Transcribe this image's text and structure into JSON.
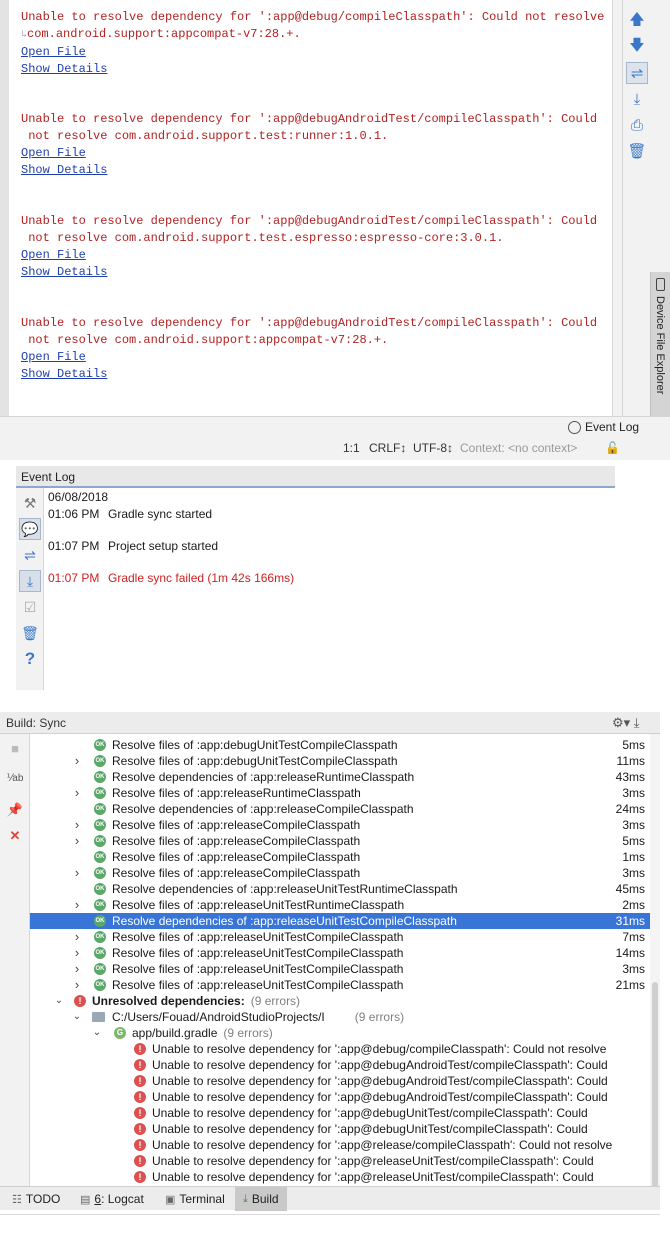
{
  "event_detail": {
    "messages": [
      {
        "line1": "Unable to resolve dependency for ':app@debug/compileClasspath': Could not resolve",
        "line2": "com.android.support:appcompat-v7:28.+.",
        "open_file": "Open File",
        "show_details": "Show Details"
      },
      {
        "line1": "Unable to resolve dependency for ':app@debugAndroidTest/compileClasspath': Could",
        "line2": " not resolve com.android.support.test:runner:1.0.1.",
        "open_file": "Open File",
        "show_details": "Show Details"
      },
      {
        "line1": "Unable to resolve dependency for ':app@debugAndroidTest/compileClasspath': Could",
        "line2": " not resolve com.android.support.test.espresso:espresso-core:3.0.1.",
        "open_file": "Open File",
        "show_details": "Show Details"
      },
      {
        "line1": "Unable to resolve dependency for ':app@debugAndroidTest/compileClasspath': Could",
        "line2": " not resolve com.android.support:appcompat-v7:28.+.",
        "open_file": "Open File",
        "show_details": "Show Details"
      }
    ],
    "side_tab_label": "Device File Explorer",
    "eventlog_button": "Event Log",
    "status": {
      "position": "1:1",
      "line_sep": "CRLF↕",
      "encoding": "UTF-8↕",
      "context": "Context: <no context>"
    }
  },
  "event_log": {
    "title": "Event Log",
    "date": "06/08/2018",
    "entries": [
      {
        "time": "01:06 PM",
        "text": "Gradle sync started"
      },
      {
        "time": "01:07 PM",
        "text": "Project setup started"
      },
      {
        "time": "01:07 PM",
        "text": "Gradle sync failed (1m 42s 166ms)"
      }
    ]
  },
  "build": {
    "title": "Build: Sync",
    "rows": [
      {
        "text": "Resolve files of :app:debugUnitTestCompileClasspath",
        "ms": "5ms",
        "arrow": false
      },
      {
        "text": "Resolve files of :app:debugUnitTestCompileClasspath",
        "ms": "11ms",
        "arrow": true
      },
      {
        "text": "Resolve dependencies of :app:releaseRuntimeClasspath",
        "ms": "43ms",
        "arrow": false
      },
      {
        "text": "Resolve files of :app:releaseRuntimeClasspath",
        "ms": "3ms",
        "arrow": true
      },
      {
        "text": "Resolve dependencies of :app:releaseCompileClasspath",
        "ms": "24ms",
        "arrow": false
      },
      {
        "text": "Resolve files of :app:releaseCompileClasspath",
        "ms": "3ms",
        "arrow": true
      },
      {
        "text": "Resolve files of :app:releaseCompileClasspath",
        "ms": "5ms",
        "arrow": true
      },
      {
        "text": "Resolve files of :app:releaseCompileClasspath",
        "ms": "1ms",
        "arrow": false
      },
      {
        "text": "Resolve files of :app:releaseCompileClasspath",
        "ms": "3ms",
        "arrow": true
      },
      {
        "text": "Resolve dependencies of :app:releaseUnitTestRuntimeClasspath",
        "ms": "45ms",
        "arrow": false
      },
      {
        "text": "Resolve files of :app:releaseUnitTestRuntimeClasspath",
        "ms": "2ms",
        "arrow": true
      },
      {
        "text": "Resolve dependencies of :app:releaseUnitTestCompileClasspath",
        "ms": "31ms",
        "arrow": false
      },
      {
        "text": "Resolve files of :app:releaseUnitTestCompileClasspath",
        "ms": "7ms",
        "arrow": true
      },
      {
        "text": "Resolve files of :app:releaseUnitTestCompileClasspath",
        "ms": "14ms",
        "arrow": true
      },
      {
        "text": "Resolve files of :app:releaseUnitTestCompileClasspath",
        "ms": "3ms",
        "arrow": true
      },
      {
        "text": "Resolve files of :app:releaseUnitTestCompileClasspath",
        "ms": "21ms",
        "arrow": true
      }
    ],
    "selected_index": 11,
    "unresolved_label": "Unresolved dependencies:",
    "unresolved_count": "(9 errors)",
    "project_path": "C:/Users/Fouad/AndroidStudioProjects/I",
    "project_count": "(9 errors)",
    "gradle_file": "app/build.gradle",
    "gradle_count": "(9 errors)",
    "errors": [
      "Unable to resolve dependency for ':app@debug/compileClasspath': Could not resolve",
      "Unable to resolve dependency for ':app@debugAndroidTest/compileClasspath': Could",
      "Unable to resolve dependency for ':app@debugAndroidTest/compileClasspath': Could",
      "Unable to resolve dependency for ':app@debugAndroidTest/compileClasspath': Could",
      "Unable to resolve dependency for ':app@debugUnitTest/compileClasspath': Could",
      "Unable to resolve dependency for ':app@debugUnitTest/compileClasspath': Could",
      "Unable to resolve dependency for ':app@release/compileClasspath': Could not resolve",
      "Unable to resolve dependency for ':app@releaseUnitTest/compileClasspath': Could",
      "Unable to resolve dependency for ':app@releaseUnitTest/compileClasspath': Could"
    ],
    "tabs": {
      "todo": "TODO",
      "logcat_num": "6",
      "logcat": ": Logcat",
      "terminal": "Terminal",
      "build": "Build"
    }
  }
}
